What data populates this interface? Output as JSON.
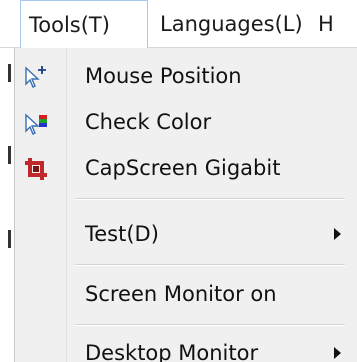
{
  "menubar": {
    "tools_label": "Tools(T)",
    "languages_label": "Languages(L)",
    "help_label": "H"
  },
  "dropdown": {
    "items": [
      {
        "label": "Mouse Position",
        "icon": "mouse-cursor-plus-icon"
      },
      {
        "label": "Check Color",
        "icon": "cursor-color-check-icon"
      },
      {
        "label": "CapScreen Gigabit",
        "icon": "crop-icon"
      },
      {
        "label": "Test(D)",
        "submenu": true
      },
      {
        "label": "Screen Monitor on"
      },
      {
        "label": "Desktop Monitor",
        "submenu": true
      }
    ]
  },
  "colors": {
    "active_border": "#a5c8ec",
    "menu_background": "#f0f0f0",
    "crop_icon": "#c0282b"
  }
}
